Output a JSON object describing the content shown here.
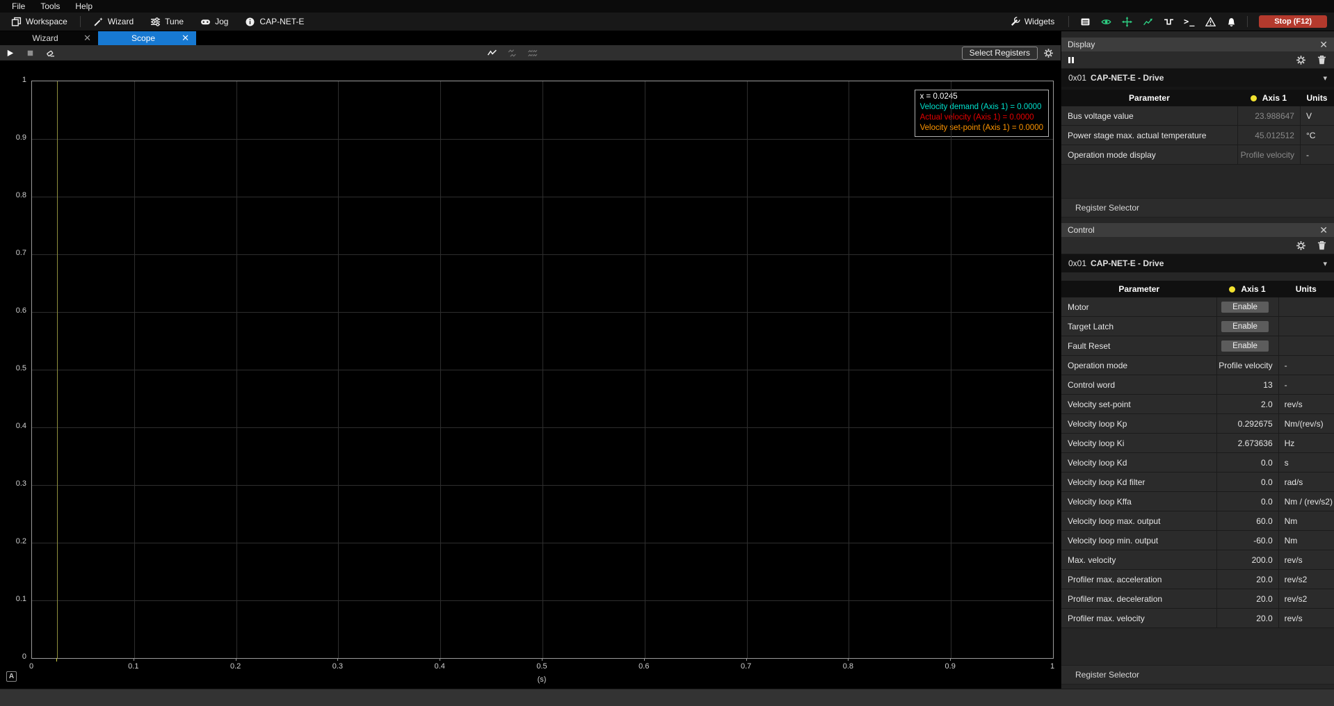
{
  "menu": {
    "items": [
      "File",
      "Tools",
      "Help"
    ]
  },
  "toolbar": {
    "buttons": [
      {
        "id": "workspace",
        "label": "Workspace",
        "icon": "workspace-icon",
        "sep_after": true
      },
      {
        "id": "wizard",
        "label": "Wizard",
        "icon": "wand-icon",
        "sep_after": false
      },
      {
        "id": "tune",
        "label": "Tune",
        "icon": "sliders-icon",
        "sep_after": false
      },
      {
        "id": "jog",
        "label": "Jog",
        "icon": "gamepad-icon",
        "sep_after": false
      },
      {
        "id": "device-info",
        "label": "CAP-NET-E",
        "icon": "info-icon",
        "sep_after": false
      }
    ],
    "widgets_label": "Widgets",
    "status_icons": [
      {
        "name": "registers-table-icon",
        "icon": "table",
        "color": "#ffffff"
      },
      {
        "name": "monitor-eye-icon",
        "icon": "eye",
        "color": "#2ed184"
      },
      {
        "name": "motion-move-icon",
        "icon": "move",
        "color": "#2ed184"
      },
      {
        "name": "scope-chart-icon",
        "icon": "chart",
        "color": "#2ed184"
      },
      {
        "name": "square-wave-icon",
        "icon": "squarewave",
        "color": "#ffffff"
      },
      {
        "name": "console-terminal-icon",
        "icon": "terminal",
        "color": "#ffffff"
      },
      {
        "name": "faults-warning-icon",
        "icon": "warning",
        "color": "#ffffff"
      },
      {
        "name": "notifications-bell-icon",
        "icon": "bell",
        "color": "#ffffff"
      }
    ],
    "stop_button": {
      "label": "Stop (F12)",
      "color": "#b43a2d"
    }
  },
  "tabs": [
    {
      "label": "Wizard",
      "active": false
    },
    {
      "label": "Scope",
      "active": true
    }
  ],
  "scope": {
    "select_registers_label": "Select Registers",
    "autoscale_label": "A",
    "toolbar_icons": [
      {
        "name": "play-icon",
        "color": "#ffffff"
      },
      {
        "name": "stop-record-icon",
        "color": "#8f8f8f"
      },
      {
        "name": "clear-eraser-icon",
        "color": "#e8e8e8"
      }
    ],
    "line_style_icons": [
      {
        "name": "signal-line-icon",
        "color": "#f0f0f0"
      },
      {
        "name": "interpolation-icon",
        "color": "#6f6f6f"
      },
      {
        "name": "interpolation-off-icon",
        "color": "#6f6f6f"
      }
    ]
  },
  "chart_data": {
    "type": "line",
    "title": "",
    "xlabel": "(s)",
    "ylabel": "",
    "xlim": [
      0,
      1
    ],
    "ylim": [
      0,
      1
    ],
    "grid": true,
    "x_ticks": [
      "0",
      "0.1",
      "0.2",
      "0.3",
      "0.4",
      "0.5",
      "0.6",
      "0.7",
      "0.8",
      "0.9",
      "1"
    ],
    "y_ticks": [
      "1",
      "0.9",
      "0.8",
      "0.7",
      "0.6",
      "0.5",
      "0.4",
      "0.3",
      "0.2",
      "0.1",
      "0"
    ],
    "cursor": {
      "x": 0.0245,
      "label": "x = 0.0245",
      "color": "#8f8f3e"
    },
    "series": [
      {
        "name": "Velocity demand (Axis 1)",
        "color": "#00e0cc",
        "value_display": "0.0000",
        "values": [
          0.0
        ],
        "x": [
          0.0245
        ]
      },
      {
        "name": "Actual velocity (Axis 1)",
        "color": "#e60000",
        "value_display": "0.0000",
        "values": [
          0.0
        ],
        "x": [
          0.0245
        ]
      },
      {
        "name": "Velocity set-point (Axis 1)",
        "color": "#ff9500",
        "value_display": "0.0000",
        "values": [
          0.0
        ],
        "x": [
          0.0245
        ]
      }
    ],
    "note": "scope idle - all series flat at 0, cursor at x=0.0245"
  },
  "display_panel": {
    "title": "Display",
    "device": {
      "address": "0x01",
      "name": "CAP-NET-E - Drive"
    },
    "headers": {
      "parameter": "Parameter",
      "axis": "Axis 1",
      "units": "Units"
    },
    "axis_dot_color": "#f2e230",
    "rows": [
      {
        "parameter": "Bus voltage value",
        "value": "23.988647",
        "units": "V"
      },
      {
        "parameter": "Power stage max. actual temperature",
        "value": "45.012512",
        "units": "°C"
      },
      {
        "parameter": "Operation mode display",
        "value": "Profile velocity",
        "units": "-"
      }
    ],
    "register_selector_label": "Register Selector"
  },
  "control_panel": {
    "title": "Control",
    "device": {
      "address": "0x01",
      "name": "CAP-NET-E - Drive"
    },
    "headers": {
      "parameter": "Parameter",
      "axis": "Axis 1",
      "units": "Units"
    },
    "axis_dot_color": "#f2e230",
    "rows": [
      {
        "parameter": "Motor",
        "button": "Enable",
        "units": ""
      },
      {
        "parameter": "Target Latch",
        "button": "Enable",
        "units": ""
      },
      {
        "parameter": "Fault Reset",
        "button": "Enable",
        "units": ""
      },
      {
        "parameter": "Operation mode",
        "value": "Profile velocity",
        "units": "-"
      },
      {
        "parameter": "Control word",
        "value": "13",
        "units": "-"
      },
      {
        "parameter": "Velocity set-point",
        "value": "2.0",
        "units": "rev/s"
      },
      {
        "parameter": "Velocity loop Kp",
        "value": "0.292675",
        "units": "Nm/(rev/s)"
      },
      {
        "parameter": "Velocity loop Ki",
        "value": "2.673636",
        "units": "Hz"
      },
      {
        "parameter": "Velocity loop Kd",
        "value": "0.0",
        "units": "s"
      },
      {
        "parameter": "Velocity loop Kd filter",
        "value": "0.0",
        "units": "rad/s"
      },
      {
        "parameter": "Velocity loop Kffa",
        "value": "0.0",
        "units": "Nm / (rev/s2)"
      },
      {
        "parameter": "Velocity loop max. output",
        "value": "60.0",
        "units": "Nm"
      },
      {
        "parameter": "Velocity loop min. output",
        "value": "-60.0",
        "units": "Nm"
      },
      {
        "parameter": "Max. velocity",
        "value": "200.0",
        "units": "rev/s"
      },
      {
        "parameter": "Profiler max. acceleration",
        "value": "20.0",
        "units": "rev/s2"
      },
      {
        "parameter": "Profiler max. deceleration",
        "value": "20.0",
        "units": "rev/s2"
      },
      {
        "parameter": "Profiler max. velocity",
        "value": "20.0",
        "units": "rev/s"
      }
    ],
    "register_selector_label": "Register Selector"
  },
  "colors": {
    "accent_blue": "#1779d2",
    "icon_green": "#2ed184",
    "stop_red": "#b43a2d",
    "cursor_yellow": "#8f8f3e",
    "axis_dot_yellow": "#f2e230"
  }
}
